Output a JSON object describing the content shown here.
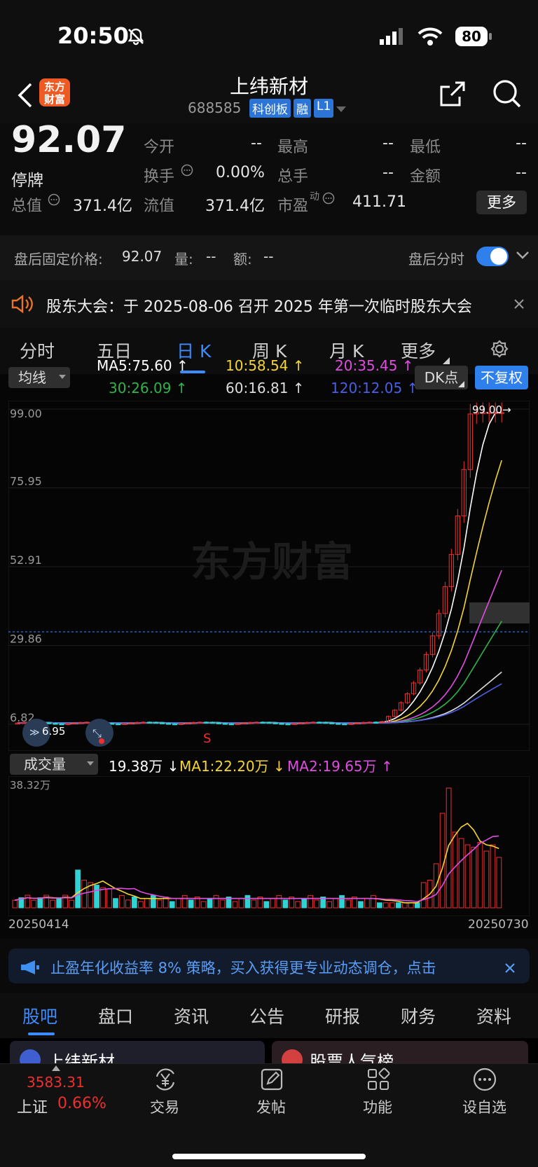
{
  "status_bar": {
    "time": "20:50",
    "battery": "80"
  },
  "header": {
    "stock_name": "上纬新材",
    "stock_code": "688585",
    "badges": [
      "科创板",
      "融",
      "L1"
    ],
    "logo_text": "东方\n财富"
  },
  "quote": {
    "price": "92.07",
    "state": "停牌",
    "fields": [
      {
        "label": "今开",
        "value": "--"
      },
      {
        "label": "最高",
        "value": "--"
      },
      {
        "label": "最低",
        "value": "--"
      },
      {
        "label": "换手",
        "value": "0.00%"
      },
      {
        "label": "总手",
        "value": "--"
      },
      {
        "label": "金额",
        "value": "--"
      }
    ],
    "row3": [
      {
        "label": "总值",
        "value": "371.4亿"
      },
      {
        "label": "流值",
        "value": "371.4亿"
      },
      {
        "label": "市盈",
        "sup": "动",
        "value": "411.71"
      }
    ],
    "more_label": "更多"
  },
  "after_hours": {
    "price_label": "盘后固定价格:",
    "price": "92.07",
    "vol_label": "量:",
    "vol": "--",
    "amt_label": "额:",
    "amt": "--",
    "toggle_label": "盘后分时"
  },
  "notice": {
    "text": "股东大会：于 2025-08-06 召开 2025 年第一次临时股东大会"
  },
  "tabs": [
    "分时",
    "五日",
    "日 K",
    "周 K",
    "月 K",
    "更多"
  ],
  "indicators": {
    "selector": "均线",
    "ma_row1": [
      {
        "text": "MA5:75.60 ↑",
        "color": "#ffffff"
      },
      {
        "text": "10:58.54 ↑",
        "color": "#f4d534"
      },
      {
        "text": "20:35.45 ↑",
        "color": "#e04de0"
      }
    ],
    "ma_row2": [
      {
        "text": "30:26.09 ↑",
        "color": "#2fb34a"
      },
      {
        "text": "60:16.81 ↑",
        "color": "#dddddd"
      },
      {
        "text": "120:12.05 ↑",
        "color": "#4a5fe3"
      }
    ],
    "dk_label": "DK点",
    "adjust_label": "不复权"
  },
  "chart_data": [
    {
      "type": "candlestick",
      "y_ticks": [
        "99.00",
        "75.95",
        "52.91",
        "29.86",
        "6.82"
      ],
      "ylim": [
        6.82,
        99.0
      ],
      "high_marker": "99.00→",
      "low_marker": "6.95",
      "sell_marker": "S",
      "watermark": "东方财富",
      "last_close": 92.07
    },
    {
      "type": "bar",
      "selector": "成交量",
      "labels": [
        {
          "text": "19.38万 ↓",
          "color": "#ffffff"
        },
        {
          "text": "MA1:22.20万 ↓",
          "color": "#f4d534"
        },
        {
          "text": "MA2:19.65万 ↑",
          "color": "#e04de0"
        }
      ],
      "y_max_label": "38.32万",
      "x_start": "20250414",
      "x_end": "20250730"
    }
  ],
  "ad": {
    "text": "止盈年化收益率 8% 策略，买入获得更专业动态调仓，点击"
  },
  "sub_tabs": [
    "股吧",
    "盘口",
    "资讯",
    "公告",
    "研报",
    "财务",
    "资料"
  ],
  "cards": [
    "上纬新材",
    "股票人气榜"
  ],
  "bottom_bar": {
    "index_value": "3583.31",
    "index_name": "上证",
    "index_change": "0.66%",
    "items": [
      "交易",
      "发帖",
      "功能",
      "设自选"
    ]
  },
  "colors": {
    "accent": "#3b82f6",
    "up": "#ee2f2f",
    "down": "#2fd3d3"
  }
}
